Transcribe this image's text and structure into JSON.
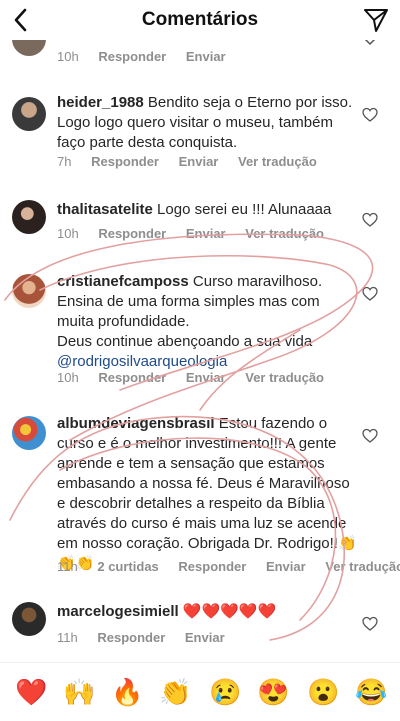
{
  "header": {
    "title": "Comentários"
  },
  "top_partial": {
    "time": "10h",
    "reply": "Responder",
    "send": "Enviar"
  },
  "comments": [
    {
      "user": "heider_1988",
      "text": "Bendito seja o Eterno por isso. Logo logo quero visitar o museu, também faço parte desta conquista.",
      "time": "7h",
      "reply": "Responder",
      "send": "Enviar",
      "translate": "Ver tradução"
    },
    {
      "user": "thalitasatelite",
      "text": "Logo serei eu !!! Alunaaaa",
      "time": "10h",
      "reply": "Responder",
      "send": "Enviar",
      "translate": "Ver tradução"
    },
    {
      "user": "cristianefcamposs",
      "text": "Curso maravilhoso. Ensina de uma forma simples mas com muita profundidade.",
      "text2": "Deus continue abençoando a sua vida",
      "mention": "@rodrigosilvaarqueologia",
      "time": "10h",
      "reply": "Responder",
      "send": "Enviar",
      "translate": "Ver tradução"
    },
    {
      "user": "albumdeviagensbrasil",
      "text": "Estou fazendo o curso e é o melhor investimento!!! A gente aprende e tem a sensação que estamos embasando a nossa fé. Deus é Maravilhoso e descobrir detalhes a respeito da Bíblia através do curso é mais uma luz se acende em nosso coração. Obrigada Dr. Rodrigo!!👏👏👏",
      "time": "11h",
      "likes": "2 curtidas",
      "reply": "Responder",
      "send": "Enviar",
      "translate": "Ver tradução"
    },
    {
      "user": "marcelogesimiell",
      "text": "❤️❤️❤️❤️❤️",
      "time": "11h",
      "reply": "Responder",
      "send": "Enviar"
    }
  ],
  "emojis": [
    "❤️",
    "🙌",
    "🔥",
    "👏",
    "😢",
    "😍",
    "😮",
    "😂"
  ],
  "icons": {
    "back": "chevron-left-icon",
    "send": "paper-plane-icon",
    "like": "heart-outline-icon"
  },
  "colors": {
    "text": "#262626",
    "meta": "#8e8e8e",
    "mention": "#1e4b8a",
    "scribble": "#e2a0a0"
  }
}
